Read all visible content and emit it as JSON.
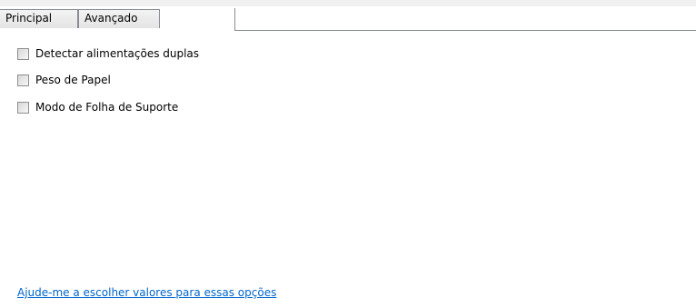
{
  "tabs": [
    {
      "label": "Principal"
    },
    {
      "label": "Avançado"
    }
  ],
  "options": [
    {
      "label": "Detectar alimentações duplas",
      "checked": false
    },
    {
      "label": "Peso de Papel",
      "checked": false
    },
    {
      "label": "Modo de Folha de Suporte",
      "checked": false
    }
  ],
  "help_link": {
    "label": "Ajude-me a escolher valores para essas opções"
  },
  "colors": {
    "link": "#0066cc",
    "tab_border": "#898c95",
    "background": "#ffffff"
  }
}
